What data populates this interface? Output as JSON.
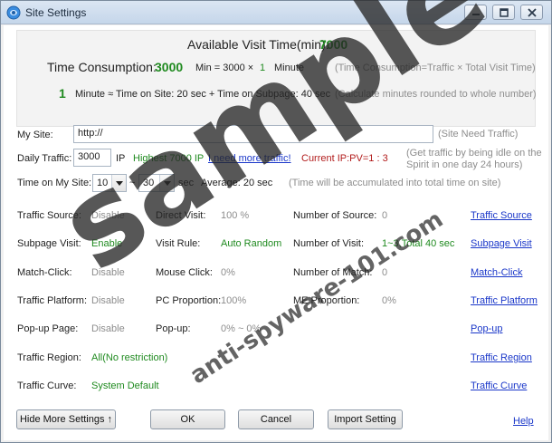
{
  "window": {
    "title": "Site Settings"
  },
  "summary": {
    "available_label": "Available Visit Time(min):",
    "available_value": "7000",
    "consumption_label": "Time Consumption:",
    "consumption_value": "3000",
    "formula_min": "Min = 3000 ×",
    "formula_mult": "1",
    "formula_unit": "Minute",
    "formula_note": "(Time Consumption=Traffic × Total Visit Time)",
    "minute_value": "1",
    "minute_text": "Minute ≈ Time on Site: 20 sec + Time on Subpage: 40 sec",
    "minute_note": "(Calculate minutes rounded to whole number)"
  },
  "my_site": {
    "label": "My Site:",
    "value": "http://",
    "note": "(Site Need Traffic)"
  },
  "daily_traffic": {
    "label": "Daily Traffic:",
    "value": "3000",
    "unit": "IP",
    "highest": "Highest 7000 IP",
    "more_link": "I need more traffic!",
    "current": "Current IP:PV=1 : 3",
    "note_line1": "(Get traffic by being idle on the",
    "note_line2": "Spirit in one day 24 hours)"
  },
  "time_on_site": {
    "label": "Time on My Site:",
    "from": "10",
    "tilde": "~",
    "to": "30",
    "unit": "sec",
    "average": "Average: 20 sec",
    "note": "(Time will be accumulated into total time on site)"
  },
  "rows": [
    {
      "c1_label": "Traffic Source:",
      "c1_value": "Disable",
      "c1_state": "disabled",
      "c2_label": "Direct Visit:",
      "c2_value": "100 %",
      "c2_state": "disabled",
      "c3_label": "Number of Source:",
      "c3_value": "0",
      "c3_state": "disabled",
      "link": "Traffic Source"
    },
    {
      "c1_label": "Subpage Visit:",
      "c1_value": "Enable",
      "c1_state": "enabled",
      "c2_label": "Visit Rule:",
      "c2_value": "Auto Random",
      "c2_state": "enabled",
      "c3_label": "Number of Visit:",
      "c3_value": "1~3,Total 40 sec",
      "c3_state": "enabled",
      "link": "Subpage Visit"
    },
    {
      "c1_label": "Match-Click:",
      "c1_value": "Disable",
      "c1_state": "disabled",
      "c2_label": "Mouse Click:",
      "c2_value": "0%",
      "c2_state": "disabled",
      "c3_label": "Number of Match:",
      "c3_value": "0",
      "c3_state": "disabled",
      "link": "Match-Click"
    },
    {
      "c1_label": "Traffic Platform:",
      "c1_value": "Disable",
      "c1_state": "disabled",
      "c2_label": "PC Proportion:",
      "c2_value": "100%",
      "c2_state": "disabled",
      "c3_label": "ME Proportion:",
      "c3_value": "0%",
      "c3_state": "disabled",
      "link": "Traffic Platform"
    },
    {
      "c1_label": "Pop-up Page:",
      "c1_value": "Disable",
      "c1_state": "disabled",
      "c2_label": "Pop-up:",
      "c2_value": "0% ~ 0%",
      "c2_state": "disabled",
      "c3_label": "",
      "c3_value": "",
      "c3_state": "disabled",
      "link": "Pop-up"
    },
    {
      "c1_label": "Traffic Region:",
      "c1_value": "All(No restriction)",
      "c1_state": "enabled",
      "c2_label": "",
      "c2_value": "",
      "c2_state": "disabled",
      "c3_label": "",
      "c3_value": "",
      "c3_state": "disabled",
      "link": "Traffic Region"
    },
    {
      "c1_label": "Traffic Curve:",
      "c1_value": "System Default",
      "c1_state": "enabled",
      "c2_label": "",
      "c2_value": "",
      "c2_state": "disabled",
      "c3_label": "",
      "c3_value": "",
      "c3_state": "disabled",
      "link": "Traffic Curve"
    }
  ],
  "footer": {
    "hide_more": "Hide More Settings ↑",
    "ok": "OK",
    "cancel": "Cancel",
    "import": "Import Setting",
    "help": "Help"
  },
  "watermark": {
    "main": "sample",
    "sub": "anti-spyware-101.com"
  },
  "colors": {
    "enabled_value": "#1f8a1f",
    "disabled_value": "#8d8d8d",
    "link": "#1a37c9",
    "alert": "#b21c1c"
  }
}
